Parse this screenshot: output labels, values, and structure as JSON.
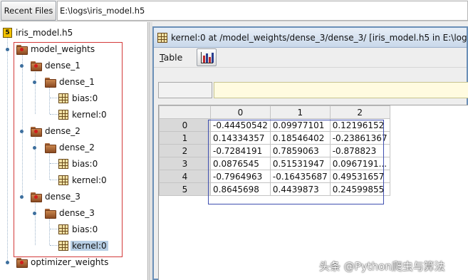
{
  "topbar": {
    "recent_files_label": "Recent Files",
    "path_value": "E:\\logs\\iris_model.h5"
  },
  "tree": {
    "root": "iris_model.h5",
    "model_weights": "model_weights",
    "dense_1_group": "dense_1",
    "dense_1_sub": "dense_1",
    "dense_1_bias": "bias:0",
    "dense_1_kernel": "kernel:0",
    "dense_2_group": "dense_2",
    "dense_2_sub": "dense_2",
    "dense_2_bias": "bias:0",
    "dense_2_kernel": "kernel:0",
    "dense_3_group": "dense_3",
    "dense_3_sub": "dense_3",
    "dense_3_bias": "bias:0",
    "dense_3_kernel": "kernel:0",
    "optimizer_weights": "optimizer_weights"
  },
  "frame": {
    "title": "kernel:0  at  /model_weights/dense_3/dense_3/  [iris_model.h5  in  E:\\logs]",
    "menu_table": "Table",
    "menu_table_mnemonic": "T",
    "menu_table_rest": "able",
    "cell_value": ""
  },
  "table": {
    "columns": [
      "0",
      "1",
      "2"
    ],
    "rows": [
      {
        "index": "0",
        "cells": [
          "-0.44450542",
          "0.09977101",
          "0.12196152"
        ]
      },
      {
        "index": "1",
        "cells": [
          "0.14334357",
          "0.18546402",
          "-0.23861367"
        ]
      },
      {
        "index": "2",
        "cells": [
          "-0.7284191",
          "0.7859063",
          "-0.878823"
        ]
      },
      {
        "index": "3",
        "cells": [
          "0.0876545",
          "0.51531947",
          "0.0967191..."
        ]
      },
      {
        "index": "4",
        "cells": [
          "-0.7964963",
          "-0.16435687",
          "0.49531657"
        ]
      },
      {
        "index": "5",
        "cells": [
          "0.8645698",
          "0.4439873",
          "0.24599855"
        ]
      }
    ]
  },
  "watermark": "头条 @Python爬虫与算法",
  "colors": {
    "selection": "#b8cfe5",
    "frame_border": "#6a8fb7",
    "annotation_red": "#d33a3a",
    "annotation_blue": "#3f4fb0",
    "cell_input_bg": "#fffbe0"
  }
}
